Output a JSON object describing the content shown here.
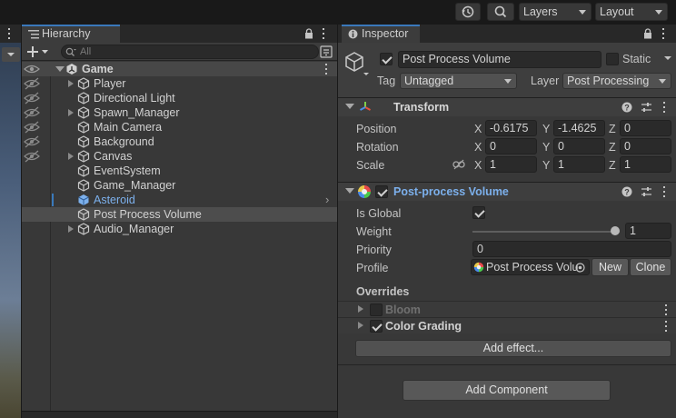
{
  "toolbar": {
    "layers_label": "Layers",
    "layout_label": "Layout"
  },
  "hierarchy": {
    "tab_label": "Hierarchy",
    "search_placeholder": "All",
    "scene": {
      "label": "Game"
    },
    "items": [
      {
        "label": "Player",
        "has_children": true,
        "selected": false,
        "highlighted": false
      },
      {
        "label": "Directional Light",
        "has_children": false,
        "selected": false,
        "highlighted": false
      },
      {
        "label": "Spawn_Manager",
        "has_children": true,
        "selected": false,
        "highlighted": false
      },
      {
        "label": "Main Camera",
        "has_children": false,
        "selected": false,
        "highlighted": false
      },
      {
        "label": "Background",
        "has_children": false,
        "selected": false,
        "highlighted": false
      },
      {
        "label": "Canvas",
        "has_children": true,
        "selected": false,
        "highlighted": false
      },
      {
        "label": "EventSystem",
        "has_children": false,
        "selected": false,
        "highlighted": false
      },
      {
        "label": "Game_Manager",
        "has_children": false,
        "selected": false,
        "highlighted": false
      },
      {
        "label": "Asteroid",
        "has_children": false,
        "selected": false,
        "highlighted": true
      },
      {
        "label": "Post Process Volume",
        "has_children": false,
        "selected": true,
        "highlighted": false
      },
      {
        "label": "Audio_Manager",
        "has_children": true,
        "selected": false,
        "highlighted": false
      }
    ]
  },
  "inspector": {
    "tab_label": "Inspector",
    "object": {
      "name": "Post Process Volume",
      "active": true,
      "static_label": "Static",
      "static": false,
      "tag_label": "Tag",
      "tag_value": "Untagged",
      "layer_label": "Layer",
      "layer_value": "Post Processing"
    },
    "transform": {
      "title": "Transform",
      "position_label": "Position",
      "rotation_label": "Rotation",
      "scale_label": "Scale",
      "x_label": "X",
      "y_label": "Y",
      "z_label": "Z",
      "position": {
        "x": "-0.6175",
        "y": "-1.4625",
        "z": "0"
      },
      "rotation": {
        "x": "0",
        "y": "0",
        "z": "0"
      },
      "scale": {
        "x": "1",
        "y": "1",
        "z": "1"
      }
    },
    "post_process": {
      "title": "Post-process Volume",
      "enabled": true,
      "is_global_label": "Is Global",
      "is_global": true,
      "weight_label": "Weight",
      "weight_value": "1",
      "weight_fraction": 1.0,
      "priority_label": "Priority",
      "priority_value": "0",
      "profile_label": "Profile",
      "profile_value": "Post Process Volu",
      "new_label": "New",
      "clone_label": "Clone",
      "overrides_label": "Overrides",
      "effects": [
        {
          "label": "Bloom",
          "enabled": false
        },
        {
          "label": "Color Grading",
          "enabled": true
        }
      ],
      "add_effect_label": "Add effect..."
    },
    "add_component_label": "Add Component"
  },
  "colors": {
    "selection_bg": "#4d4d4d",
    "highlight_text": "#7cb0ec",
    "accent_blue": "#3a79bb",
    "panel_bg": "#383838"
  }
}
